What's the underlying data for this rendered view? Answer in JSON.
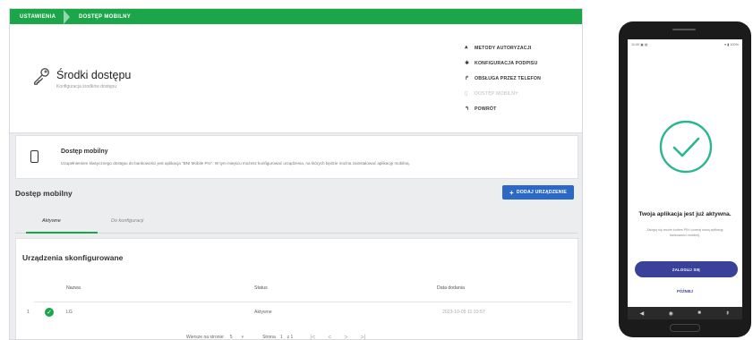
{
  "breadcrumbs": [
    "USTAWIENIA",
    "DOSTĘP MOBILNY"
  ],
  "header": {
    "title": "Środki dostępu",
    "subtitle": "Konfiguracja środków dostępu",
    "actions": [
      {
        "icon": "⩓",
        "label": "METODY AUTORYZACJI",
        "disabled": false
      },
      {
        "icon": "✱",
        "label": "KONFIGURACJA PODPISU",
        "disabled": false
      },
      {
        "icon": "↱",
        "label": "OBSŁUGA PRZEZ TELEFON",
        "disabled": false
      },
      {
        "icon": "▯",
        "label": "DOSTĘP MOBILNY",
        "disabled": true
      },
      {
        "icon": "↰",
        "label": "POWRÓT",
        "disabled": false
      }
    ]
  },
  "info_card": {
    "title": "Dostęp mobilny",
    "description": "Uzupełnieniem klasycznego dostępu do bankowości jest aplikacja \"BNI Mobile Pro\". W tym miejscu możesz konfigurować urządzenia, na których będzie można zainstalować aplikację mobilną."
  },
  "section_title": "Dostęp mobilny",
  "add_button": {
    "icon": "+",
    "label": "DODAJ URZĄDZENIE"
  },
  "tabs": [
    {
      "label": "Aktywne",
      "active": true
    },
    {
      "label": "Do konfiguracji",
      "active": false
    }
  ],
  "table": {
    "title": "Urządzenia skonfigurowane",
    "columns": [
      "Nazwa",
      "Status",
      "Data dodania"
    ],
    "rows": [
      {
        "num": "1",
        "name": "LG",
        "status": "Aktywne",
        "date": "2023-10-05 11:10:57"
      }
    ]
  },
  "pagination": {
    "rows_per_page_label": "Wiersze na stronie:",
    "rows_per_page": "5",
    "page_label": "Strona",
    "page": "1",
    "of_label": "z 1",
    "nav": [
      "|<",
      "<",
      ">",
      ">|"
    ]
  },
  "phone": {
    "status_left": "11:00 ▣ ▤",
    "status_right": "▾ ▮ 100%",
    "title": "Twoja aplikacja jest już aktywna.",
    "description": "Zaloguj się swoim kodem PIN i poznaj nową aplikację bankowości mobilnej.",
    "primary_button": "ZALOGUJ SIĘ",
    "secondary_link": "PÓŹNIEJ",
    "nav": [
      "◀",
      "◉",
      "■",
      "⇞"
    ]
  },
  "colors": {
    "accent_green": "#1ca64a",
    "button_blue": "#2c69c7",
    "phone_button": "#3a4198",
    "check_teal": "#2ab68f"
  }
}
